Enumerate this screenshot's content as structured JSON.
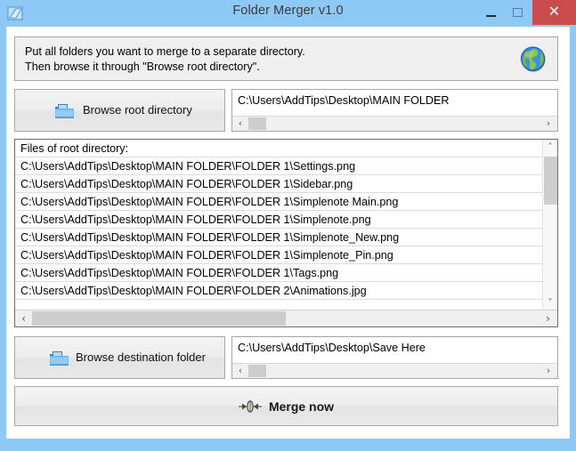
{
  "window": {
    "title": "Folder Merger v1.0",
    "icon": "folder-app-icon",
    "titlebar_color": "#8ec8f5",
    "close_color": "#cb4c4c",
    "controls": {
      "minimize": "minimize-icon",
      "maximize": "maximize-icon",
      "close": "✕"
    }
  },
  "info": {
    "line1": "Put all folders you want to merge to a separate directory.",
    "line2": "Then browse it through \"Browse root directory\".",
    "icon": "globe-icon"
  },
  "root_section": {
    "button_label": "Browse root directory",
    "button_icon": "folder-icon",
    "path_value": "C:\\Users\\AddTips\\Desktop\\MAIN FOLDER",
    "scroll_left": "‹",
    "scroll_right": "›"
  },
  "file_list": {
    "header": "Files of root directory:",
    "rows": [
      "C:\\Users\\AddTips\\Desktop\\MAIN FOLDER\\FOLDER 1\\Settings.png",
      "C:\\Users\\AddTips\\Desktop\\MAIN FOLDER\\FOLDER 1\\Sidebar.png",
      "C:\\Users\\AddTips\\Desktop\\MAIN FOLDER\\FOLDER 1\\Simplenote Main.png",
      "C:\\Users\\AddTips\\Desktop\\MAIN FOLDER\\FOLDER 1\\Simplenote.png",
      "C:\\Users\\AddTips\\Desktop\\MAIN FOLDER\\FOLDER 1\\Simplenote_New.png",
      "C:\\Users\\AddTips\\Desktop\\MAIN FOLDER\\FOLDER 1\\Simplenote_Pin.png",
      "C:\\Users\\AddTips\\Desktop\\MAIN FOLDER\\FOLDER 1\\Tags.png",
      "C:\\Users\\AddTips\\Desktop\\MAIN FOLDER\\FOLDER 2\\Animations.jpg"
    ],
    "scroll_up": "˄",
    "scroll_down": "˅",
    "scroll_left": "‹",
    "scroll_right": "›"
  },
  "dest_section": {
    "button_label": "Browse destination folder",
    "button_icon": "folder-icon",
    "path_value": "C:\\Users\\AddTips\\Desktop\\Save Here",
    "scroll_left": "‹",
    "scroll_right": "›"
  },
  "merge": {
    "label": "Merge now",
    "icon": "merge-icon"
  }
}
